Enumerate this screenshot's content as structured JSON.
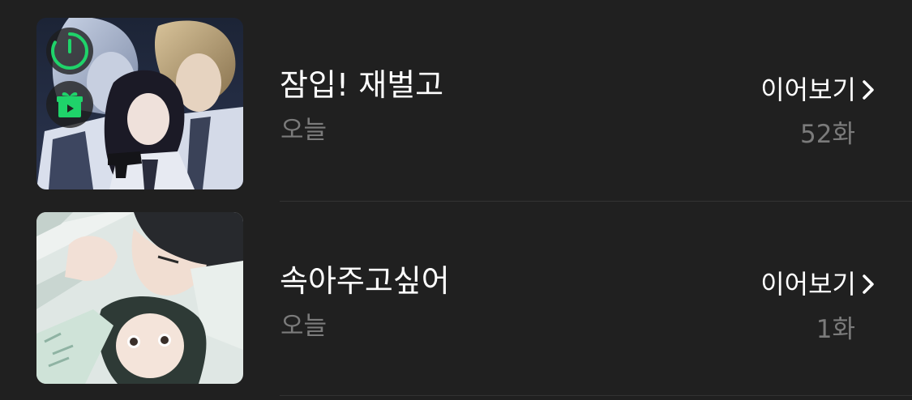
{
  "items": [
    {
      "title": "잠입! 재벌고",
      "updated": "오늘",
      "continue_label": "이어보기",
      "episode": "52화",
      "badges": [
        "timer-icon",
        "gift-icon"
      ]
    },
    {
      "title": "속아주고싶어",
      "updated": "오늘",
      "continue_label": "이어보기",
      "episode": "1화",
      "badges": []
    }
  ],
  "colors": {
    "background": "#202020",
    "accent_green": "#1fd36a",
    "secondary_text": "#7b7b7b",
    "divider": "#333333"
  }
}
